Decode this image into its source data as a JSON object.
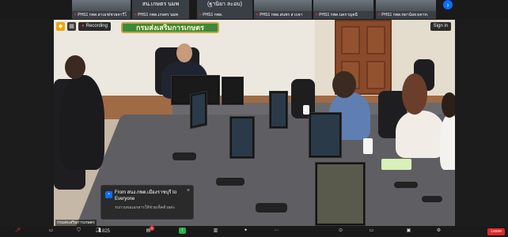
{
  "gallery": {
    "tiles": [
      {
        "name": "PHS1 กพด.สาเมช/ชวยคาวีโ",
        "caption": ""
      },
      {
        "name": "PHS1 กพด.เกษตร นมพ",
        "caption": "สน.เกษตร นมพ"
      },
      {
        "name": "PHS1 กพด.",
        "caption": "(ฐานิยา ละอบ)"
      },
      {
        "name": "PHS1 กพด.สนพร ส เบจา",
        "caption": ""
      },
      {
        "name": "PHS1 กพด.นคกาญจนี",
        "caption": ""
      },
      {
        "name": "PHS1 กพด.ทยาน้อย ผคาท.",
        "caption": ""
      }
    ],
    "next_icon": "chevron-right-icon"
  },
  "video": {
    "sign_text": "กรมส่งเสริมการเกษตร",
    "recording_label": "Recording",
    "sign_in_label": "Sign in",
    "bottom_name": "กรมส่งเสริมการเกษตร"
  },
  "chat_notification": {
    "from_text": "From สนง.กพด.เมืองราชบุรี to Everyone",
    "message": "รบกวนขอเอกสารให้ช่วยเช็คด้วยค่ะ"
  },
  "toolbar": {
    "participants_count": "825",
    "chat_badge": "1",
    "leave_label": "Leave"
  },
  "colors": {
    "accent": "#0b6cff",
    "leave": "#e02828",
    "recording": "#e53935"
  }
}
